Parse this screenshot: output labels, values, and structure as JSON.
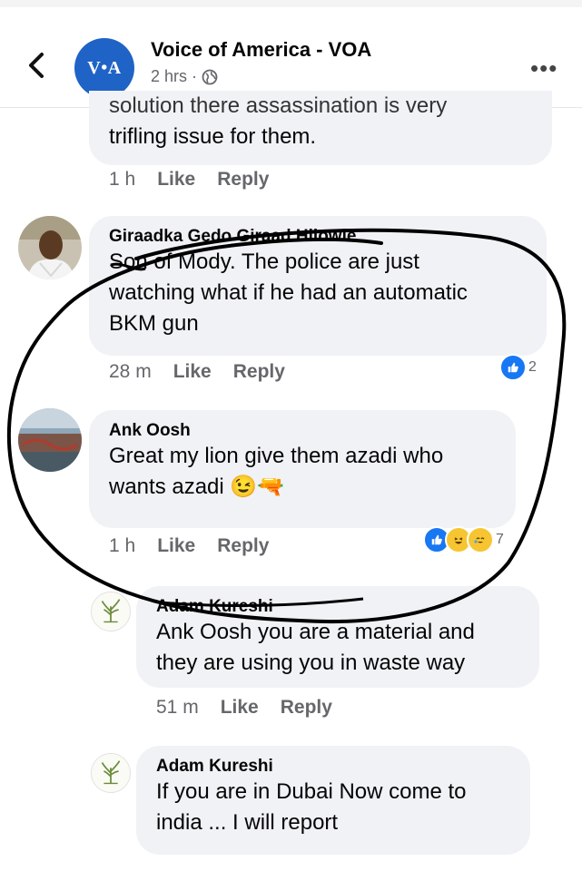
{
  "header": {
    "page_name": "Voice of America - VOA",
    "time": "2 hrs",
    "separator": "·",
    "logo_text": "V•A",
    "more_label": "•••"
  },
  "comments": [
    {
      "text_partial": "solution there assassination is very",
      "text": "trifling issue for them.",
      "time": "1 h",
      "like": "Like",
      "reply": "Reply"
    },
    {
      "author": "Giraadka Gedo Giraad Hilowle",
      "text_line1": "Son of Mody. The police are just",
      "text_line2": "watching what if he had an automatic",
      "text_line3": "BKM gun",
      "time": "28 m",
      "like": "Like",
      "reply": "Reply",
      "reaction_count": "2"
    },
    {
      "author": "Ank Oosh",
      "text_line1": "Great my lion give them azadi who",
      "text_line2": "wants azadi",
      "emoji": "😉🔫",
      "time": "1 h",
      "like": "Like",
      "reply": "Reply",
      "reaction_count": "7"
    }
  ],
  "replies": [
    {
      "author": "Adam Kureshi",
      "text_line1": "Ank Oosh you are a material and",
      "text_line2": "they are using you in waste way",
      "time": "51 m",
      "like": "Like",
      "reply": "Reply"
    },
    {
      "author": "Adam Kureshi",
      "text_line1": "If you are in Dubai Now come to",
      "text_line2": "india ... I will report"
    }
  ],
  "colors": {
    "bubble": "#f0f2f5",
    "like_blue": "#1877f2",
    "meta_gray": "#65676b",
    "scribble": "#000000"
  }
}
